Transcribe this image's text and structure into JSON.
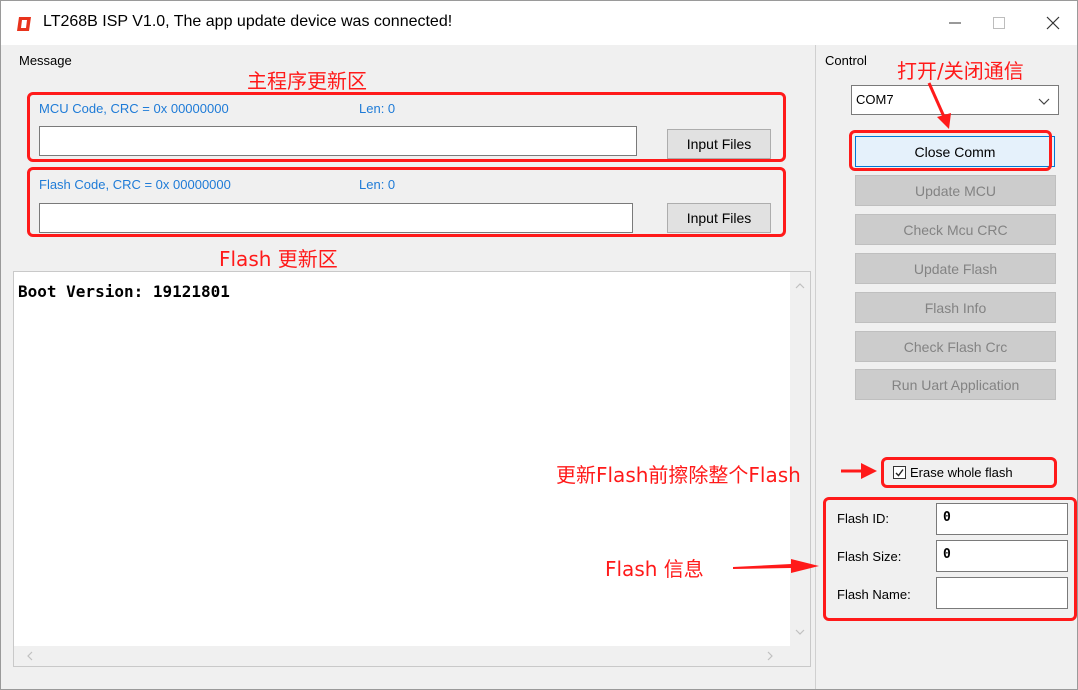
{
  "window": {
    "title": "LT268B ISP V1.0, The app update device was connected!",
    "minimize_glyph": "—",
    "maximize_glyph": "☐",
    "close_glyph": "✕"
  },
  "message": {
    "group_label": "Message",
    "mcu_code": {
      "info": "MCU Code, CRC = 0x 00000000",
      "len": "Len:  0",
      "path": "",
      "button": "Input Files"
    },
    "flash_code": {
      "info": "Flash Code, CRC = 0x 00000000",
      "len": "Len:  0",
      "path": "",
      "button": "Input Files"
    },
    "log_text": "Boot Version: 19121801"
  },
  "control": {
    "group_label": "Control",
    "com_port": "COM7",
    "buttons": [
      {
        "label": "Close Comm",
        "enabled": true
      },
      {
        "label": "Update MCU",
        "enabled": false
      },
      {
        "label": "Check Mcu CRC",
        "enabled": false
      },
      {
        "label": "Update Flash",
        "enabled": false
      },
      {
        "label": "Flash Info",
        "enabled": false
      },
      {
        "label": "Check Flash Crc",
        "enabled": false
      },
      {
        "label": "Run Uart Application",
        "enabled": false
      }
    ],
    "erase_whole_flash": {
      "label": "Erase whole flash",
      "checked": true
    }
  },
  "flash_info": {
    "id_label": "Flash ID:",
    "id_value": "0",
    "size_label": "Flash Size:",
    "size_value": "0",
    "name_label": "Flash Name:",
    "name_value": ""
  },
  "annotations": {
    "main_update_area": "主程序更新区",
    "flash_update_area": "Flash 更新区",
    "open_close_comm": "打开/关闭通信",
    "erase_note": "更新Flash前擦除整个Flash",
    "flash_info": "Flash 信息",
    "color": "#ff1a1a"
  },
  "icons": {
    "app": "app-logo-icon",
    "dropdown": "chevron-down-icon",
    "scroll_up": "chevron-up-icon",
    "scroll_down": "chevron-down-icon",
    "scroll_left": "chevron-left-icon",
    "scroll_right": "chevron-right-icon",
    "check": "checkmark-icon"
  }
}
